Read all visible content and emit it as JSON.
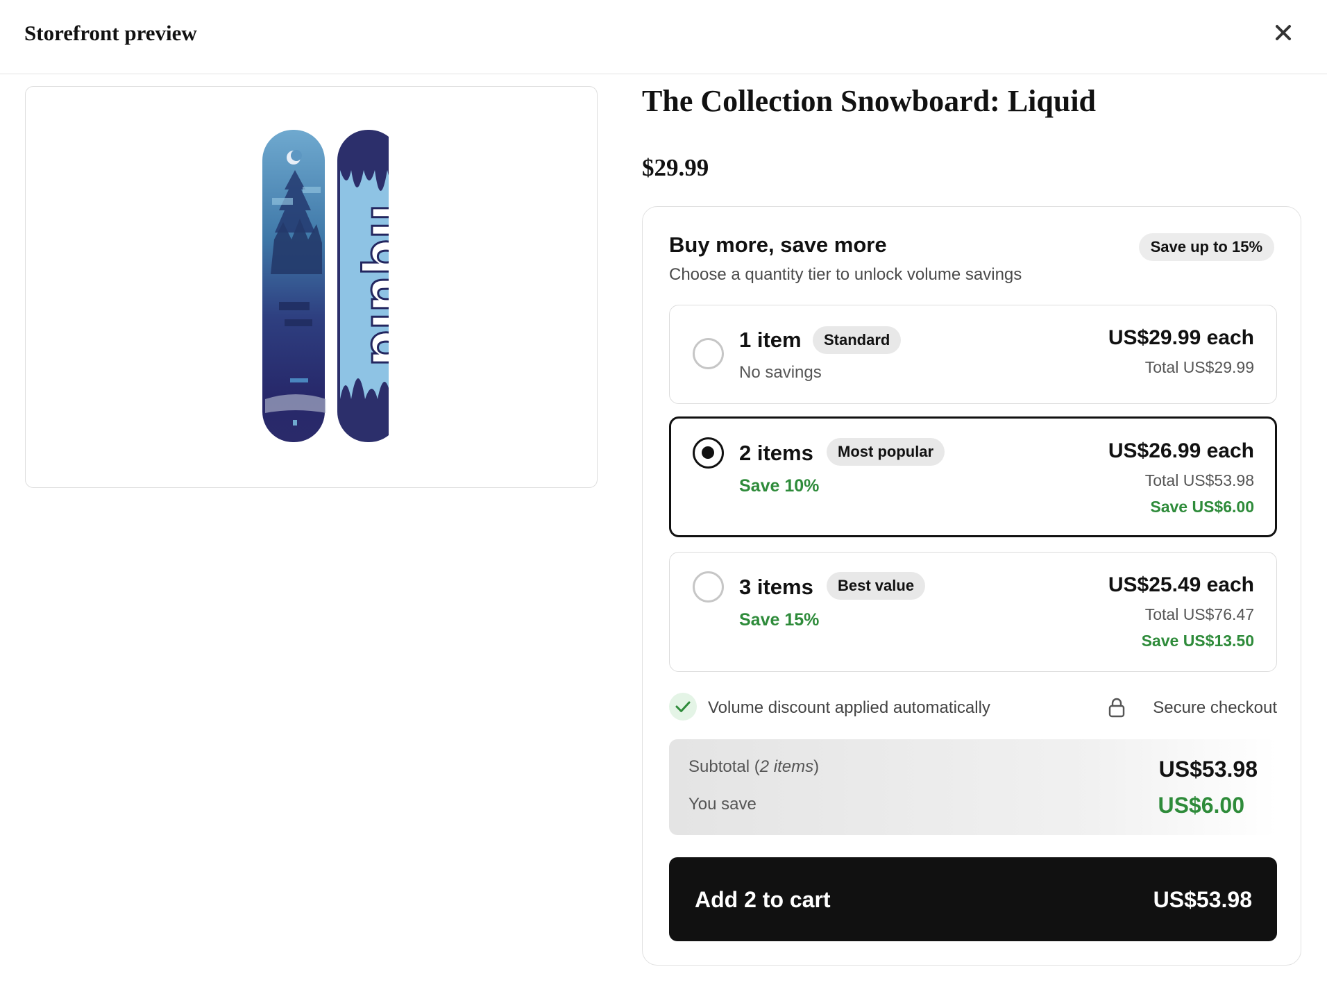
{
  "header": {
    "title": "Storefront preview",
    "close_icon": "close-icon"
  },
  "product": {
    "title": "The Collection Snowboard: Liquid",
    "price": "$29.99"
  },
  "bundle": {
    "heading": "Buy more, save more",
    "subheading": "Choose a quantity tier to unlock volume savings",
    "badge": "Save up to 15%",
    "selected_tier": 2,
    "tiers": [
      {
        "qty_label": "1 item",
        "tag": "Standard",
        "note": "No savings",
        "each": "US$29.99 each",
        "total": "Total US$29.99",
        "save": ""
      },
      {
        "qty_label": "2 items",
        "tag": "Most popular",
        "note": "Save 10%",
        "each": "US$26.99 each",
        "total": "Total US$53.98",
        "save": "Save US$6.00"
      },
      {
        "qty_label": "3 items",
        "tag": "Best value",
        "note": "Save 15%",
        "each": "US$25.49 each",
        "total": "Total US$76.47",
        "save": "Save US$13.50"
      }
    ],
    "assurance": {
      "auto_discount": "Volume discount applied automatically",
      "secure": "Secure checkout"
    },
    "summary": {
      "subtotal_label": "Subtotal",
      "subtotal_items": "2 items",
      "subtotal_value": "US$53.98",
      "savings_label": "You save",
      "savings_value": "US$6.00"
    },
    "cart": {
      "label": "Add 2 to cart",
      "total": "US$53.98"
    }
  },
  "colors": {
    "accent": "#111111",
    "savings_green": "#2e8b3a",
    "badge_bg": "#ececec"
  }
}
